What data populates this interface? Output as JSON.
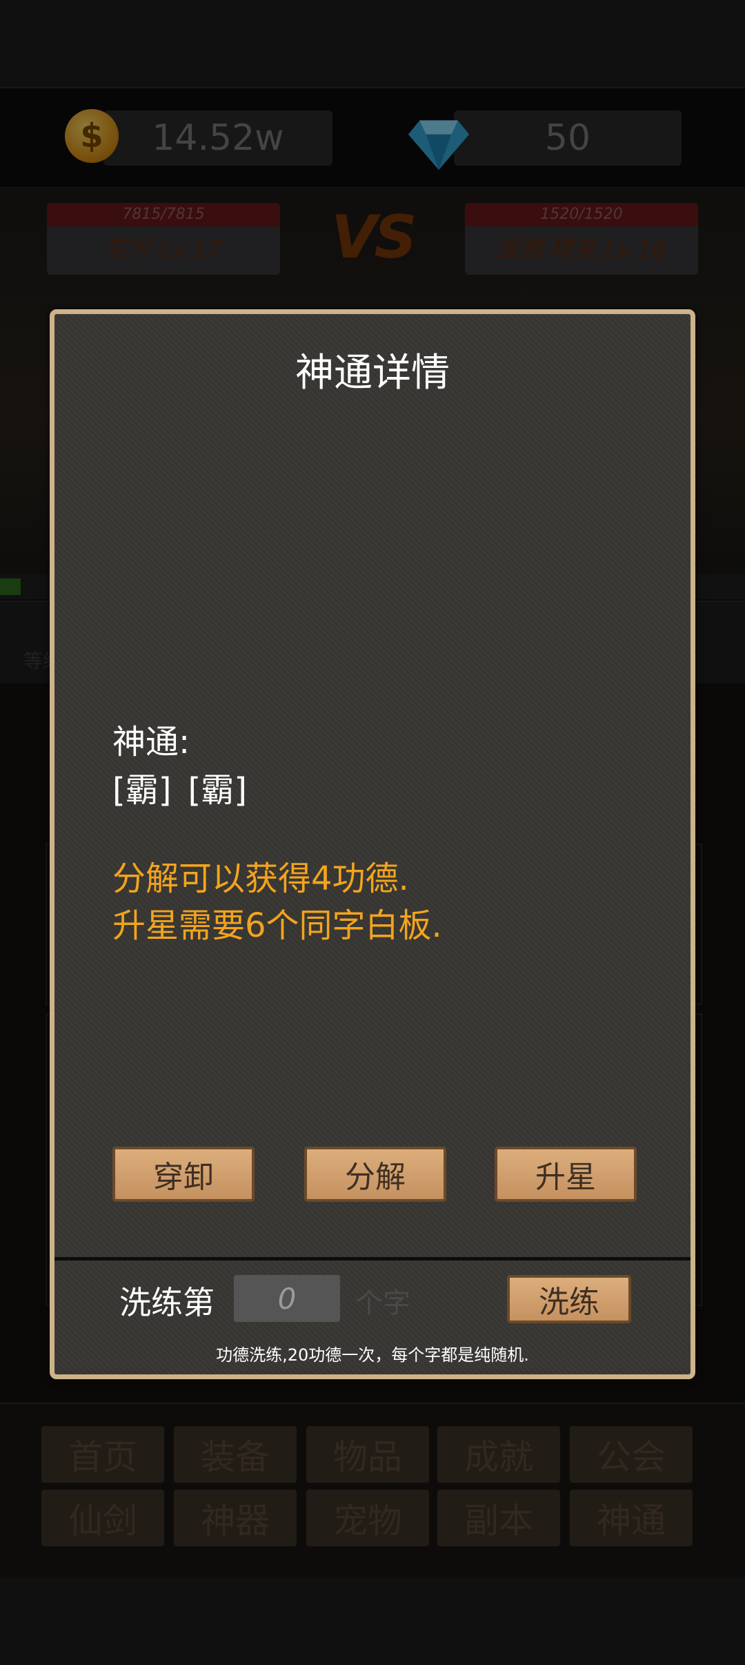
{
  "currency": {
    "coin_icon": "coin-icon",
    "coin_symbol": "$",
    "gold": "14.52w",
    "gem_icon": "diamond-icon",
    "diamonds": "50"
  },
  "battle": {
    "player": {
      "hp": "7815/7815",
      "name": "花兮 Lv.17"
    },
    "vs": "VS",
    "enemy": {
      "hp": "1520/1520",
      "name": "蛮猪·精英 Lv.16"
    }
  },
  "background_text": {
    "info_line": "等级"
  },
  "nav": {
    "row1": [
      "首页",
      "装备",
      "物品",
      "成就",
      "公会"
    ],
    "row2": [
      "仙剑",
      "神器",
      "宠物",
      "副本",
      "神通"
    ]
  },
  "dialog": {
    "title": "神通详情",
    "skill_label": "神通:",
    "skill_chars": [
      "[霸]",
      "[霸]"
    ],
    "decompose_info": "分解可以获得4功德.",
    "upgrade_info": "升星需要6个同字白板.",
    "buttons": {
      "equip": "穿卸",
      "decompose": "分解",
      "upgrade": "升星"
    },
    "wash": {
      "label": "洗练第",
      "value": "0",
      "unit": "个字",
      "button": "洗练",
      "note": "功德洗练,20功德一次，每个字都是纯随机."
    }
  },
  "colors": {
    "dialog_border": "#cdb38a",
    "info_text": "#f3a41d",
    "wood_button": "#c59160"
  }
}
